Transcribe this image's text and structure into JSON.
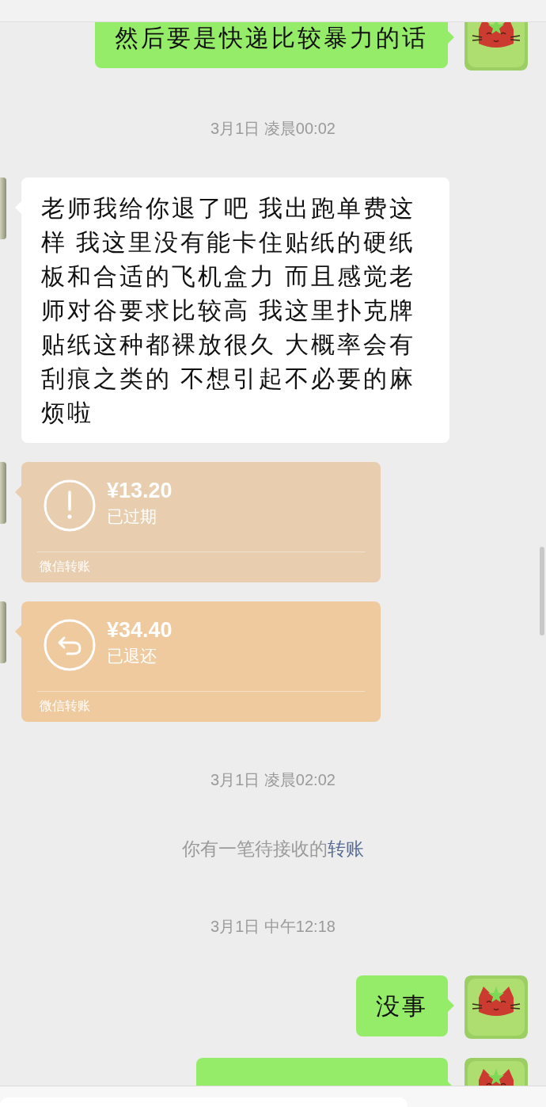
{
  "messages": [
    {
      "kind": "text",
      "outgoing": true,
      "text": "然后要是快递比较暴力的话"
    },
    {
      "kind": "time",
      "text": "3月1日 凌晨00:02"
    },
    {
      "kind": "text",
      "outgoing": false,
      "text": "老师我给你退了吧 我出跑单费这样 我这里没有能卡住贴纸的硬纸板和合适的飞机盒力 而且感觉老师对谷要求比较高 我这里扑克牌贴纸这种都裸放很久 大概率会有刮痕之类的 不想引起不必要的麻烦啦"
    },
    {
      "kind": "transfer",
      "outgoing": false,
      "refunded": false,
      "amount": "¥13.20",
      "status": "已过期",
      "footer": "微信转账"
    },
    {
      "kind": "transfer",
      "outgoing": false,
      "refunded": true,
      "amount": "¥34.40",
      "status": "已退还",
      "footer": "微信转账"
    },
    {
      "kind": "time",
      "text": "3月1日 凌晨02:02"
    },
    {
      "kind": "system",
      "text": "你有一笔待接收的",
      "link": "转账"
    },
    {
      "kind": "time",
      "text": "3月1日 中午12:18"
    },
    {
      "kind": "text",
      "outgoing": true,
      "text": "没事"
    },
    {
      "kind": "text",
      "outgoing": true
    }
  ]
}
